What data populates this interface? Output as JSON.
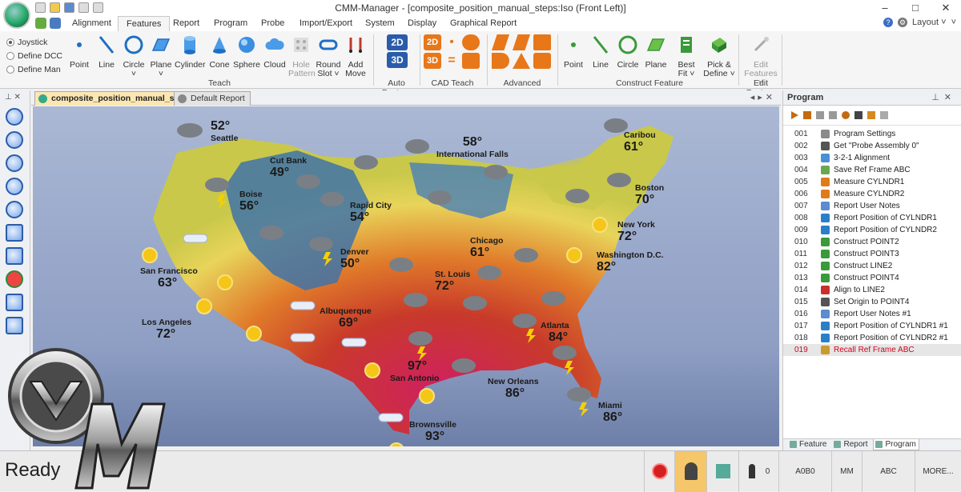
{
  "window": {
    "title": "CMM-Manager - [composite_position_manual_steps:Iso (Front Left)]",
    "controls": [
      "–",
      "□",
      "✕"
    ]
  },
  "ribbon_tabs": [
    "Alignment",
    "Features",
    "Report",
    "Program",
    "Probe",
    "Import/Export",
    "System",
    "Display",
    "Graphical Report"
  ],
  "active_tab": "Features",
  "help": {
    "layout_label": "Layout ˅"
  },
  "modes": [
    {
      "label": "Joystick",
      "selected": true
    },
    {
      "label": "Define DCC",
      "selected": false
    },
    {
      "label": "Define Man",
      "selected": false
    }
  ],
  "teach_buttons": [
    {
      "label": "Point",
      "icon": "point-icon"
    },
    {
      "label": "Line",
      "icon": "line-icon"
    },
    {
      "label": "Circle",
      "sub": "˅",
      "icon": "circle-icon"
    },
    {
      "label": "Plane",
      "sub": "˅",
      "icon": "plane-icon"
    },
    {
      "label": "Cylinder",
      "icon": "cylinder-icon"
    },
    {
      "label": "Cone",
      "icon": "cone-icon"
    },
    {
      "label": "Sphere",
      "icon": "sphere-icon"
    },
    {
      "label": "Cloud",
      "icon": "cloud-icon"
    },
    {
      "label": "Hole",
      "sub": "Pattern",
      "icon": "hole-pattern-icon",
      "disabled": true
    },
    {
      "label": "Round",
      "sub": "Slot ˅",
      "icon": "round-slot-icon"
    },
    {
      "label": "Add",
      "sub": "Move",
      "icon": "add-move-icon"
    }
  ],
  "construct_buttons": [
    {
      "label": "Point",
      "icon": "construct-point-icon"
    },
    {
      "label": "Line",
      "icon": "construct-line-icon"
    },
    {
      "label": "Circle",
      "icon": "construct-circle-icon"
    },
    {
      "label": "Plane",
      "icon": "construct-plane-icon"
    },
    {
      "label": "Best",
      "sub": "Fit ˅",
      "icon": "best-fit-icon"
    },
    {
      "label": "Pick &",
      "sub": "Define ˅",
      "icon": "pick-define-icon"
    },
    {
      "label": "Edit",
      "sub": "Features ˅",
      "icon": "edit-features-icon",
      "disabled": true
    }
  ],
  "groups": {
    "teach": "Teach",
    "auto": "Auto Feature",
    "cad": "CAD Teach",
    "advanced": "Advanced",
    "construct": "Construct Feature",
    "edit": "Edit Feature"
  },
  "auto_labels": [
    "2D",
    "3D"
  ],
  "doc_tabs": [
    {
      "label": "composite_position_manual_step...",
      "active": true
    },
    {
      "label": "Default Report",
      "active": false
    }
  ],
  "map": {
    "cities": [
      {
        "name": "Seattle",
        "temp": "52°"
      },
      {
        "name": "Cut Bank",
        "temp": "49°"
      },
      {
        "name": "International Falls",
        "temp": "58°"
      },
      {
        "name": "Caribou",
        "temp": "61°"
      },
      {
        "name": "Boise",
        "temp": "56°"
      },
      {
        "name": "Rapid City",
        "temp": "54°"
      },
      {
        "name": "Boston",
        "temp": "70°"
      },
      {
        "name": "New York",
        "temp": "72°"
      },
      {
        "name": "Chicago",
        "temp": "61°"
      },
      {
        "name": "Washington D.C.",
        "temp": "82°"
      },
      {
        "name": "San Francisco",
        "temp": "63°"
      },
      {
        "name": "Denver",
        "temp": "50°"
      },
      {
        "name": "St. Louis",
        "temp": "72°"
      },
      {
        "name": "Los Angeles",
        "temp": "72°"
      },
      {
        "name": "Albuquerque",
        "temp": "69°"
      },
      {
        "name": "Atlanta",
        "temp": "84°"
      },
      {
        "name": "San Antonio",
        "temp": "97°"
      },
      {
        "name": "New Orleans",
        "temp": "86°"
      },
      {
        "name": "Miami",
        "temp": "86°"
      },
      {
        "name": "Brownsville",
        "temp": "93°"
      }
    ]
  },
  "program_panel": {
    "title": "Program",
    "steps": [
      {
        "num": "001",
        "label": "Program Settings",
        "color": "#8a8a8a"
      },
      {
        "num": "002",
        "label": "Get \"Probe Assembly 0\"",
        "color": "#555555"
      },
      {
        "num": "003",
        "label": "3-2-1 Alignment",
        "color": "#4a8fd6"
      },
      {
        "num": "004",
        "label": "Save Ref Frame ABC",
        "color": "#6aa84f"
      },
      {
        "num": "005",
        "label": "Measure CYLNDR1",
        "color": "#e07b1a"
      },
      {
        "num": "006",
        "label": "Measure CYLNDR2",
        "color": "#e07b1a"
      },
      {
        "num": "007",
        "label": "Report User Notes",
        "color": "#5b8bd0"
      },
      {
        "num": "008",
        "label": "Report Position of CYLNDR1",
        "color": "#2a7fc9"
      },
      {
        "num": "009",
        "label": "Report Position of CYLNDR2",
        "color": "#2a7fc9"
      },
      {
        "num": "010",
        "label": "Construct POINT2",
        "color": "#3a9a3a"
      },
      {
        "num": "011",
        "label": "Construct POINT3",
        "color": "#3a9a3a"
      },
      {
        "num": "012",
        "label": "Construct LINE2",
        "color": "#3a9a3a"
      },
      {
        "num": "013",
        "label": "Construct POINT4",
        "color": "#3a9a3a"
      },
      {
        "num": "014",
        "label": "Align to LINE2",
        "color": "#c9302c"
      },
      {
        "num": "015",
        "label": "Set Origin to POINT4",
        "color": "#555555"
      },
      {
        "num": "016",
        "label": "Report User Notes #1",
        "color": "#5b8bd0"
      },
      {
        "num": "017",
        "label": "Report Position of CYLNDR1 #1",
        "color": "#2a7fc9"
      },
      {
        "num": "018",
        "label": "Report Position of CYLNDR2 #1",
        "color": "#2a7fc9"
      },
      {
        "num": "019",
        "label": "Recall Ref Frame ABC",
        "color": "#c99a2e"
      }
    ],
    "selected": "019",
    "tabs": [
      "Feature",
      "Report",
      "Program"
    ],
    "active_tab": "Program"
  },
  "status": {
    "ready": "Ready",
    "probe_count": "0",
    "probe_tip": "A0B0",
    "units": "MM",
    "ref_frame": "ABC",
    "more": "MORE..."
  }
}
